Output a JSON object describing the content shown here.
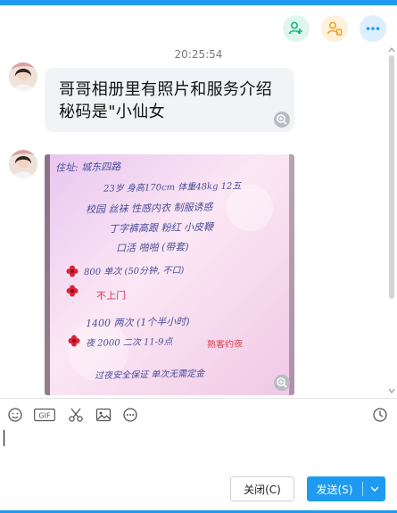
{
  "header": {
    "icons": [
      "add-contact-icon",
      "contact-card-icon",
      "more-icon"
    ]
  },
  "chat": {
    "timestamp": "20:25:54",
    "message_text": "哥哥相册里有照片和服务介绍 秘码是\"小仙女",
    "photo": {
      "lines": [
        "住址: 城东四路",
        "23岁 身高170cm 体重48kg 12五",
        "校园 丝袜 性感内衣 制服诱惑",
        "丁字裤高跟 粉红 小皮鞭",
        "口活 啪啪 (带套)",
        "800 单次 (50分钟, 不口)",
        "不上门",
        "1400 两次 (1个半小时)",
        "夜 2000 二次 11-9点",
        "熟客约夜",
        "过夜安全保证 单次无需定金"
      ]
    }
  },
  "toolbar": {
    "gif_label": "GIF",
    "icons": [
      "emoji-icon",
      "gif-icon",
      "scissors-icon",
      "image-icon",
      "more-options-icon",
      "history-clock-icon"
    ]
  },
  "actions": {
    "close_label": "关闭(C)",
    "send_label": "发送(S)"
  },
  "colors": {
    "accent": "#1e9bf0",
    "bubble": "#f2f3f6"
  }
}
